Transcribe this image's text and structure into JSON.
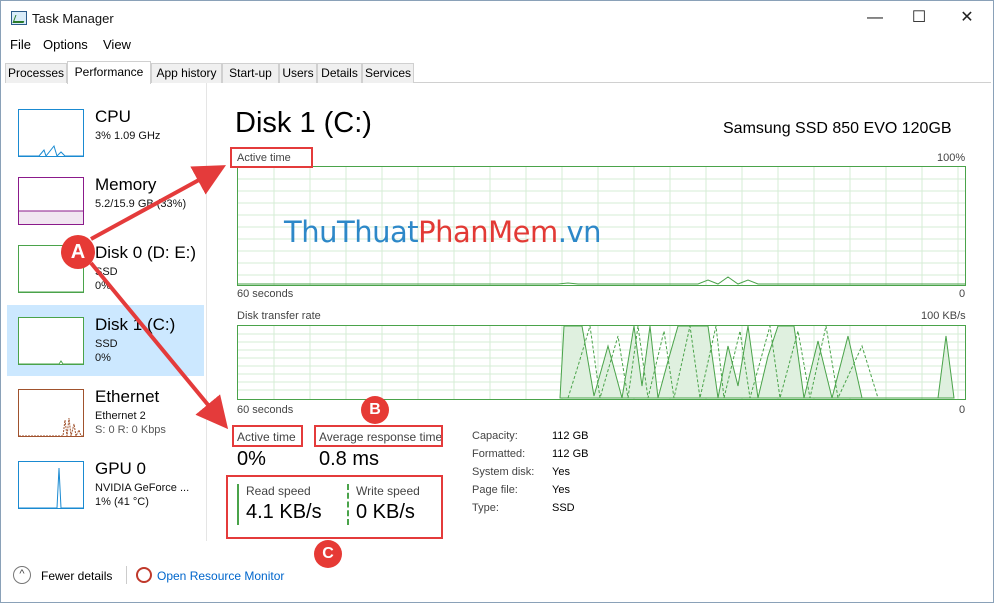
{
  "window": {
    "title": "Task Manager",
    "minimize": "—",
    "maximize": "☐",
    "close": "✕"
  },
  "menu": [
    "File",
    "Options",
    "View"
  ],
  "tabs": [
    "Processes",
    "Performance",
    "App history",
    "Start-up",
    "Users",
    "Details",
    "Services"
  ],
  "active_tab": "Performance",
  "sidebar": {
    "items": [
      {
        "name": "CPU",
        "line1": "3%  1.09 GHz",
        "line2": ""
      },
      {
        "name": "Memory",
        "line1": "5.2/15.9 GB (33%)",
        "line2": ""
      },
      {
        "name": "Disk 0 (D: E:)",
        "line1": "SSD",
        "line2": "0%"
      },
      {
        "name": "Disk 1 (C:)",
        "line1": "SSD",
        "line2": "0%"
      },
      {
        "name": "Ethernet",
        "line1": "Ethernet 2",
        "line2": "S: 0  R: 0 Kbps"
      },
      {
        "name": "GPU 0",
        "line1": "NVIDIA GeForce ...",
        "line2": "1%  (41 °C)"
      }
    ]
  },
  "detail": {
    "heading": "Disk 1 (C:)",
    "device": "Samsung SSD 850 EVO 120GB",
    "graph1": {
      "label": "Active time",
      "max": "100%",
      "xlabel": "60 seconds",
      "min": "0"
    },
    "graph2": {
      "label": "Disk transfer rate",
      "max": "100 KB/s",
      "xlabel": "60 seconds",
      "min": "0"
    },
    "stats": {
      "active_time_label": "Active time",
      "active_time_value": "0%",
      "avg_response_label": "Average response time",
      "avg_response_value": "0.8 ms",
      "read_label": "Read speed",
      "read_value": "4.1 KB/s",
      "write_label": "Write speed",
      "write_value": "0 KB/s"
    },
    "properties": [
      {
        "key": "Capacity:",
        "value": "112 GB"
      },
      {
        "key": "Formatted:",
        "value": "112 GB"
      },
      {
        "key": "System disk:",
        "value": "Yes"
      },
      {
        "key": "Page file:",
        "value": "Yes"
      },
      {
        "key": "Type:",
        "value": "SSD"
      }
    ]
  },
  "bottom": {
    "fewer_details": "Fewer details",
    "resource_monitor": "Open Resource Monitor"
  },
  "annotations": {
    "a": "A",
    "b": "B",
    "c": "C"
  },
  "watermark": {
    "part1": "ThuThuat",
    "part2": "PhanMem",
    "part3": ".vn"
  },
  "colors": {
    "accent": "#4aa34a",
    "selected": "#cce8ff",
    "annotation": "#e43b3b",
    "link": "#0066cc"
  }
}
